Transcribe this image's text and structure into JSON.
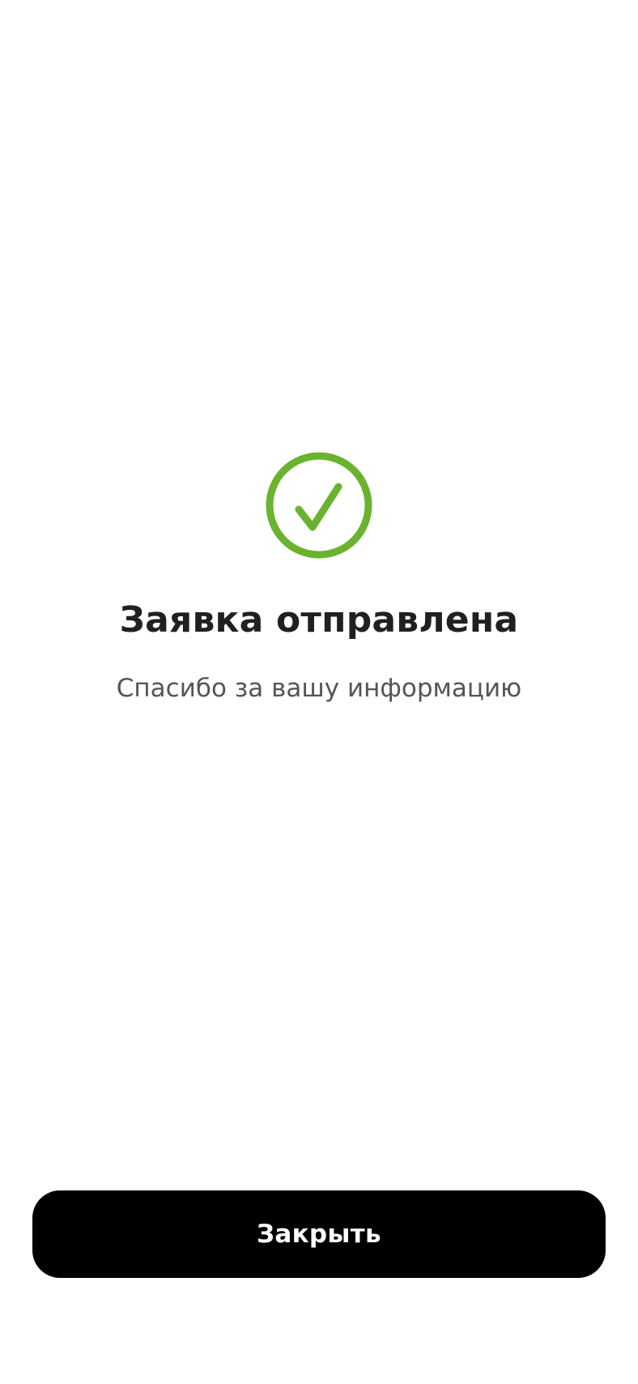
{
  "status": {
    "icon": "check-circle-icon",
    "color": "#6AB32E"
  },
  "title": "Заявка отправлена",
  "subtitle": "Спасибо за вашу информацию",
  "close_button": {
    "label": "Закрыть",
    "background": "#000000",
    "text_color": "#FFFFFF"
  }
}
